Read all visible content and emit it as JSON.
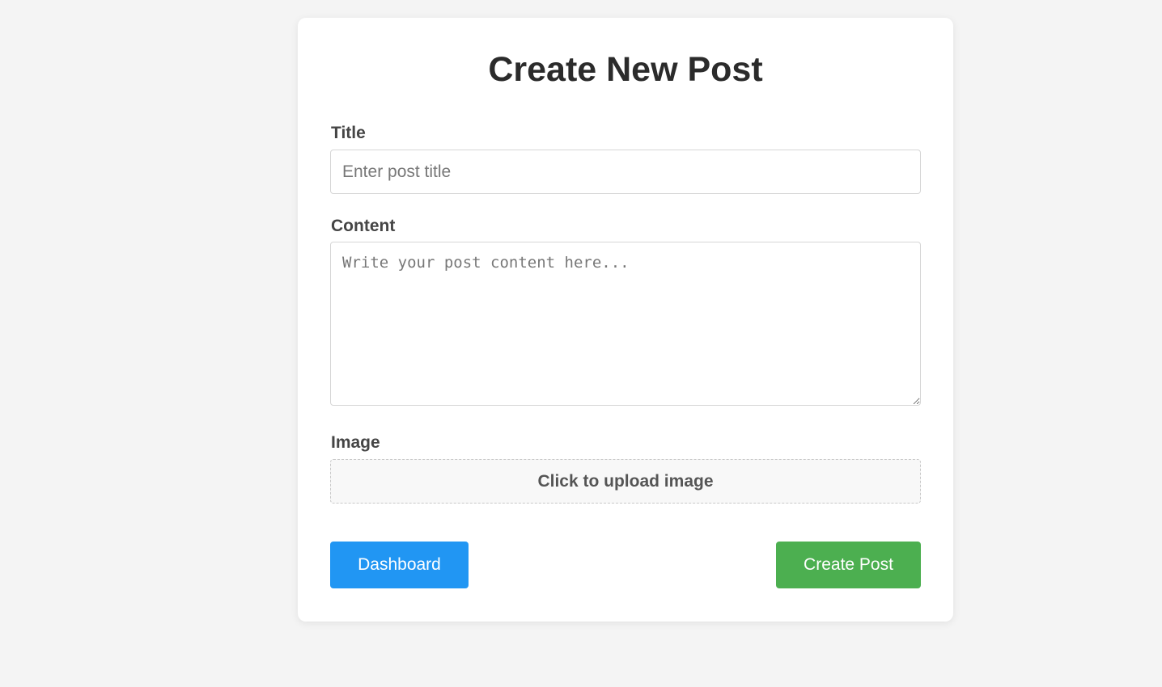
{
  "page": {
    "title": "Create New Post"
  },
  "form": {
    "title_label": "Title",
    "title_value": "",
    "title_placeholder": "Enter post title",
    "content_label": "Content",
    "content_value": "",
    "content_placeholder": "Write your post content here...",
    "image_label": "Image",
    "upload_text": "Click to upload image"
  },
  "actions": {
    "dashboard_label": "Dashboard",
    "create_label": "Create Post"
  },
  "colors": {
    "background": "#f4f4f4",
    "card": "#ffffff",
    "dashboard_button": "#2196f3",
    "create_button": "#4caf50"
  }
}
